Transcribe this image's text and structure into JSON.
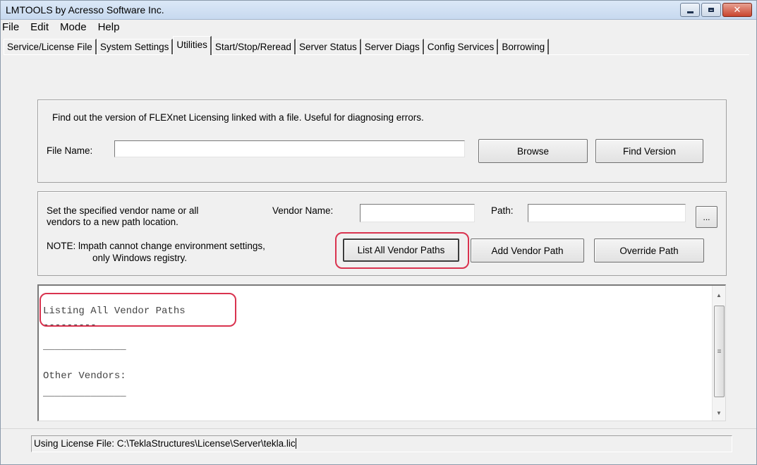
{
  "window": {
    "title": "LMTOOLS by Acresso Software Inc."
  },
  "menu": [
    "File",
    "Edit",
    "Mode",
    "Help"
  ],
  "tabs": [
    {
      "label": "Service/License File",
      "active": false
    },
    {
      "label": "System Settings",
      "active": false
    },
    {
      "label": "Utilities",
      "active": true
    },
    {
      "label": "Start/Stop/Reread",
      "active": false
    },
    {
      "label": "Server Status",
      "active": false
    },
    {
      "label": "Server Diags",
      "active": false
    },
    {
      "label": "Config Services",
      "active": false
    },
    {
      "label": "Borrowing",
      "active": false
    }
  ],
  "find_version": {
    "description": "Find out the version of FLEXnet Licensing linked with a file.  Useful for diagnosing errors.",
    "file_name_label": "File Name:",
    "file_name_value": "",
    "browse_label": "Browse",
    "find_version_label": "Find Version"
  },
  "vendor_path": {
    "description_line1": "Set the specified vendor name or all",
    "description_line2": "vendors to a new path location.",
    "vendor_name_label": "Vendor Name:",
    "vendor_name_value": "",
    "path_label": "Path:",
    "path_value": "",
    "ellipsis_label": "...",
    "note_line1": "NOTE:  lmpath cannot change environment settings,",
    "note_line2": "only Windows registry.",
    "list_all_label": "List All Vendor Paths",
    "add_vendor_label": "Add Vendor Path",
    "override_label": "Override Path"
  },
  "output_lines": [
    "---------",
    "Listing All Vendor Paths",
    "---------",
    "______________",
    "",
    "Other Vendors:",
    "______________"
  ],
  "status": {
    "text": "Using License File:  C:\\TeklaStructures\\License\\Server\\tekla.lic"
  },
  "colors": {
    "highlight": "#d9334f"
  }
}
